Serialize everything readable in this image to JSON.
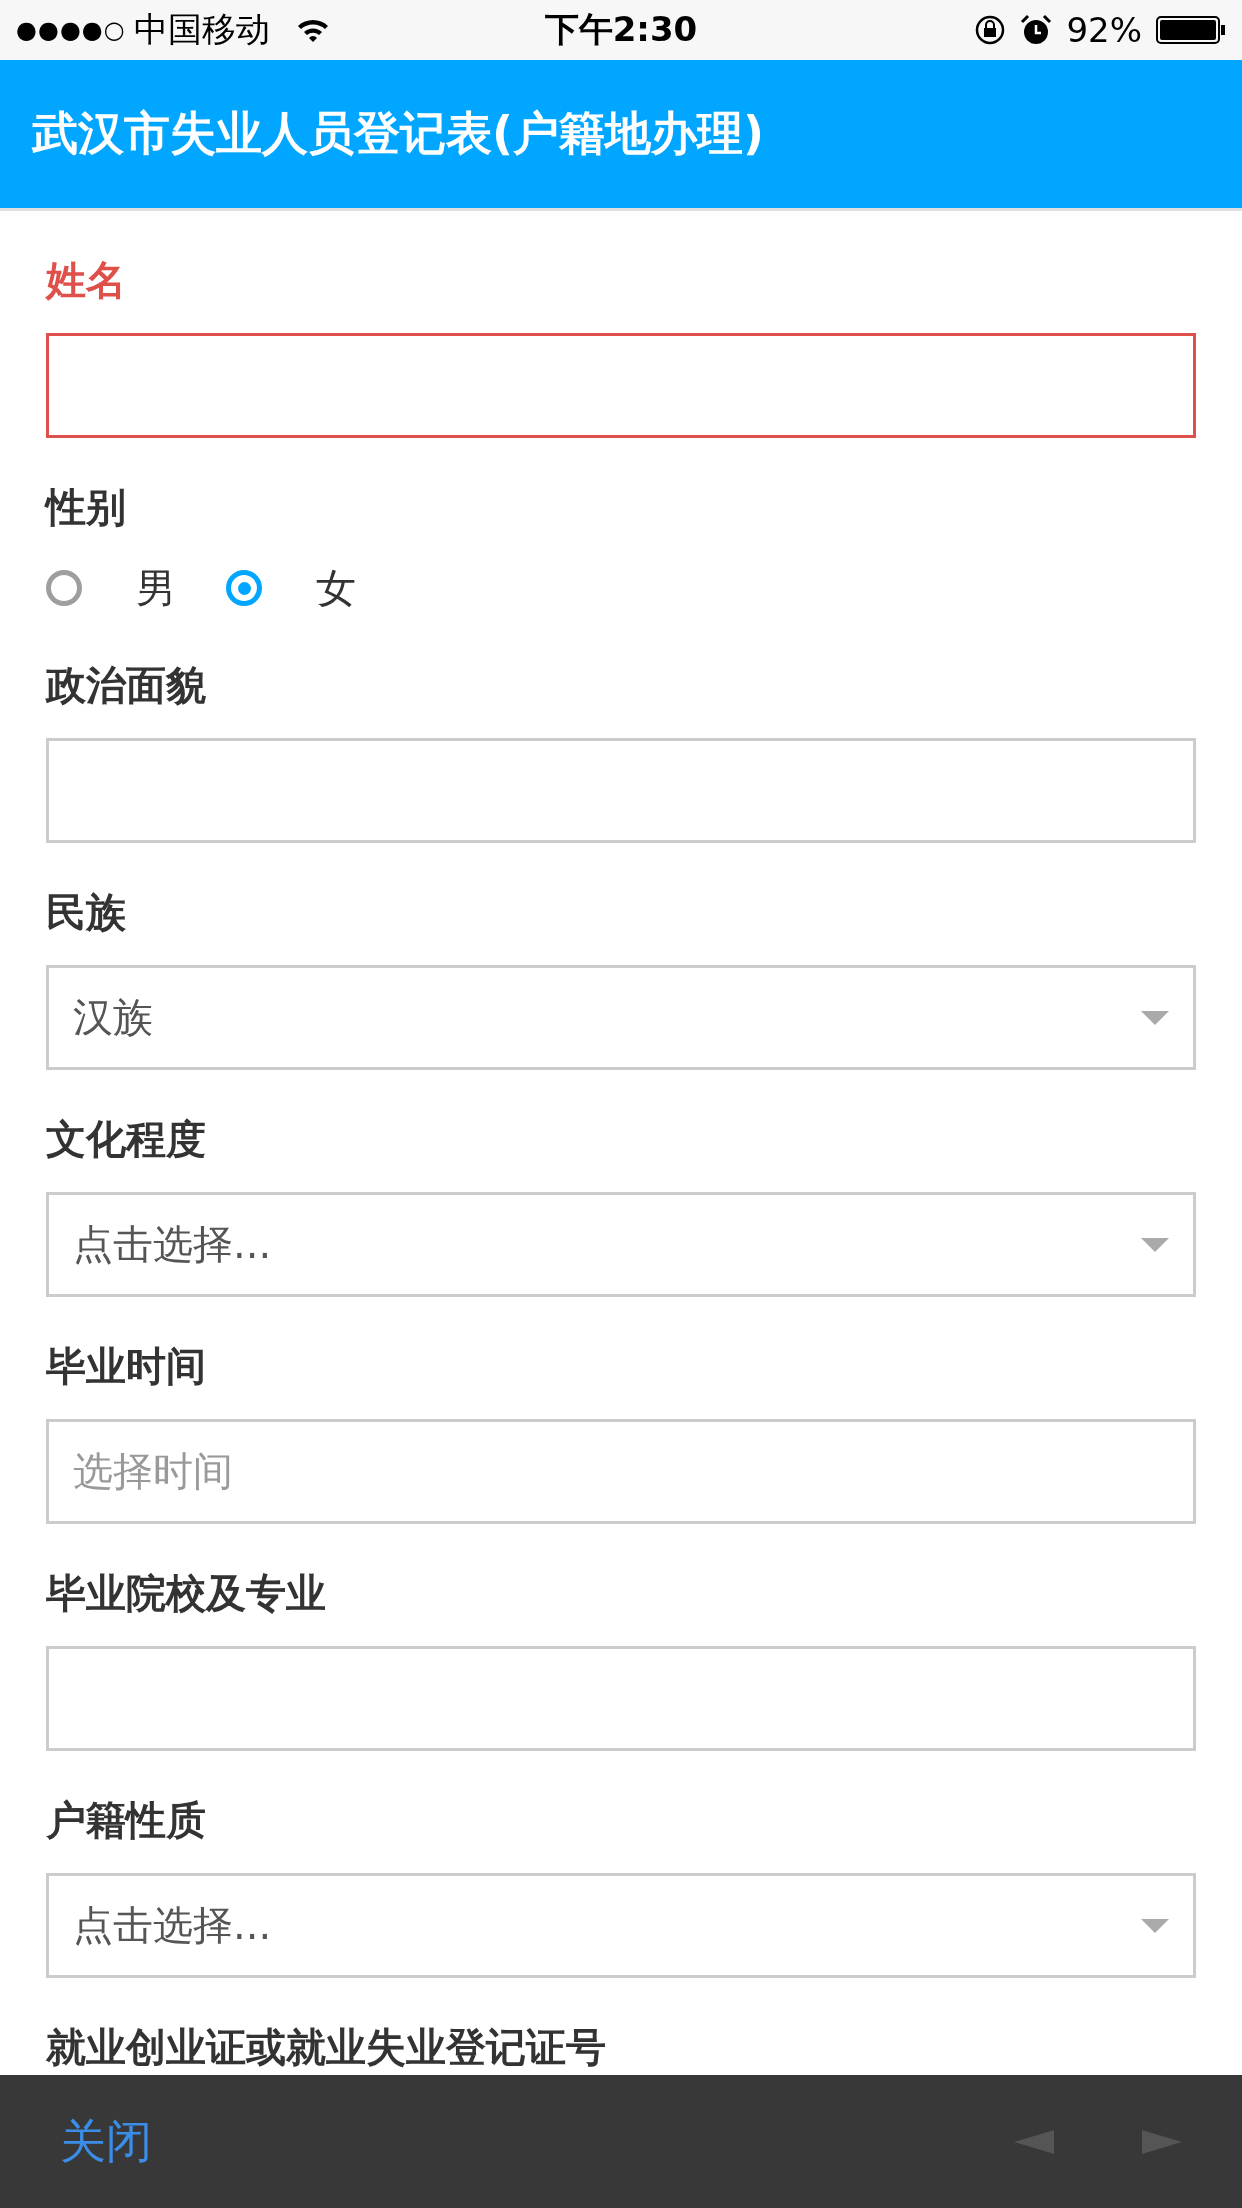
{
  "status_bar": {
    "signal": "●●●●○",
    "carrier": "中国移动",
    "time": "下午2:30",
    "battery": "92%"
  },
  "header": {
    "title": "武汉市失业人员登记表(户籍地办理)"
  },
  "fields": [
    {
      "kind": "text",
      "label": "姓名",
      "error": true
    },
    {
      "kind": "radio",
      "label": "性别",
      "options": [
        {
          "label": "男",
          "selected": false
        },
        {
          "label": "女",
          "selected": true
        }
      ]
    },
    {
      "kind": "text",
      "label": "政治面貌",
      "error": false
    },
    {
      "kind": "select",
      "label": "民族",
      "value": "汉族"
    },
    {
      "kind": "select",
      "label": "文化程度",
      "value": "点击选择..."
    },
    {
      "kind": "text",
      "label": "毕业时间",
      "placeholder": "选择时间",
      "error": false
    },
    {
      "kind": "text",
      "label": "毕业院校及专业",
      "error": false
    },
    {
      "kind": "select",
      "label": "户籍性质",
      "value": "点击选择..."
    },
    {
      "kind": "label",
      "label": "就业创业证或就业失业登记证号"
    }
  ],
  "bottom_bar": {
    "close": "关闭"
  }
}
